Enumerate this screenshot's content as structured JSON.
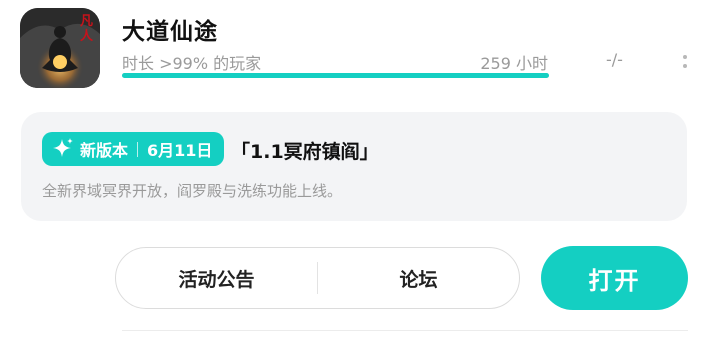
{
  "game": {
    "title": "大道仙途",
    "icon": "immortal-meditation-figure-icon",
    "icon_text": "凡人"
  },
  "playtime": {
    "label": "时长 >99% 的玩家",
    "hours": "259 小时",
    "progress": 1.0
  },
  "score": "-/-",
  "update": {
    "badge_label": "新版本",
    "badge_date": "6月11日",
    "title": "「1.1冥府镇阎」",
    "description": "全新界域冥界开放，阎罗殿与洗练功能上线。"
  },
  "actions": {
    "announcements": "活动公告",
    "forum": "论坛",
    "open": "打开"
  },
  "colors": {
    "accent": "#14cfc2",
    "card_bg": "#f3f4f6",
    "muted_text": "#9a9a9a"
  }
}
